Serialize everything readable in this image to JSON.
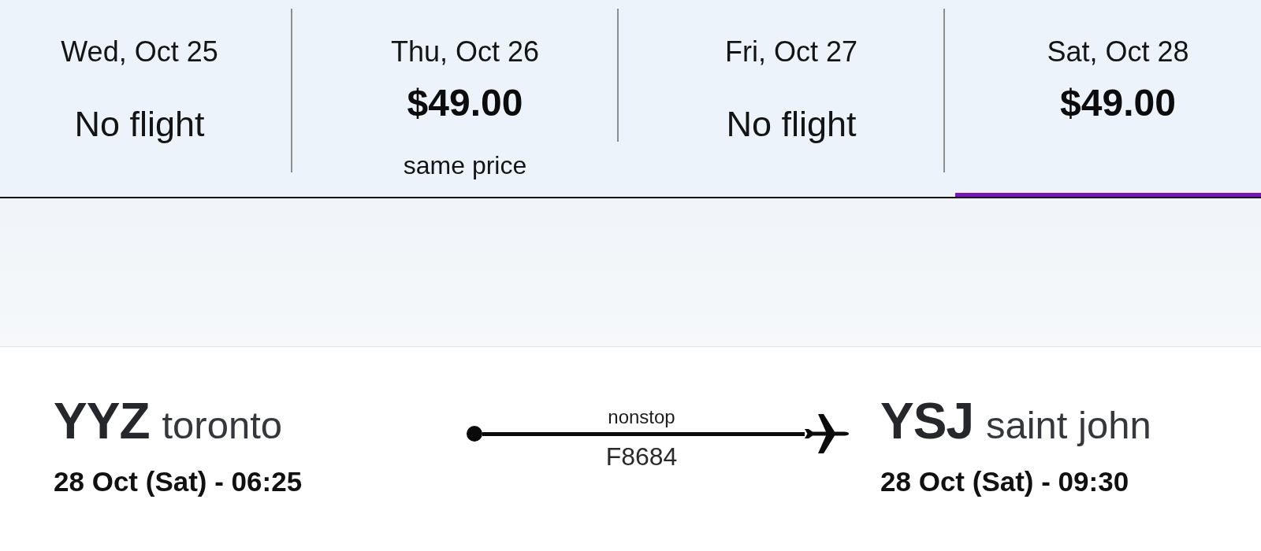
{
  "date_tabs": [
    {
      "date": "Wed, Oct 25",
      "kind": "none",
      "status": "No flight",
      "selected": false
    },
    {
      "date": "Thu, Oct 26",
      "kind": "price",
      "price": "$49.00",
      "note": "same price",
      "selected": false
    },
    {
      "date": "Fri, Oct 27",
      "kind": "none",
      "status": "No flight",
      "selected": false
    },
    {
      "date": "Sat, Oct 28",
      "kind": "price",
      "price": "$49.00",
      "selected": true
    }
  ],
  "flight": {
    "origin": {
      "code": "YYZ",
      "city": "toronto",
      "departure": "28 Oct (Sat) - 06:25"
    },
    "route": {
      "stops": "nonstop",
      "flight_number": "F8684"
    },
    "destination": {
      "code": "YSJ",
      "city": "saint john",
      "arrival": "28 Oct (Sat) - 09:30"
    }
  }
}
